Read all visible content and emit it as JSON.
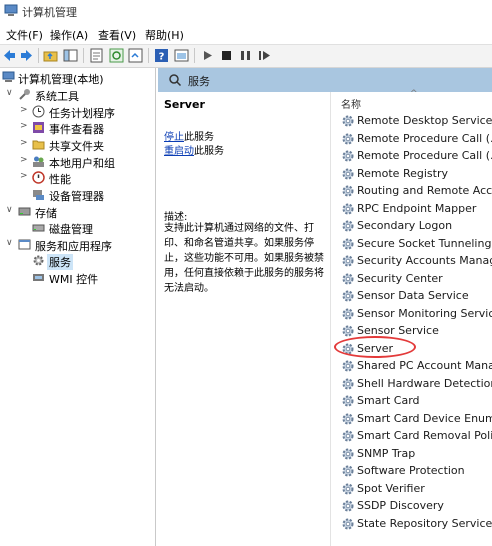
{
  "window": {
    "title": "计算机管理"
  },
  "menu": [
    "文件(F)",
    "操作(A)",
    "查看(V)",
    "帮助(H)"
  ],
  "toolbar_icons": [
    "back-icon",
    "forward-icon",
    "up-folder-icon",
    "show-tree-icon",
    "properties-icon",
    "refresh-icon",
    "export-icon",
    "help-icon",
    "console-icon",
    "play-icon",
    "stop-icon",
    "pause-icon",
    "restart-icon"
  ],
  "tree": [
    {
      "label": "计算机管理(本地)",
      "icon": "computer-icon",
      "twisty": ""
    },
    {
      "label": "系统工具",
      "icon": "tools-icon",
      "twisty": "∨"
    },
    {
      "label": "任务计划程序",
      "icon": "clock-icon",
      "twisty": ">"
    },
    {
      "label": "事件查看器",
      "icon": "event-viewer-icon",
      "twisty": ">"
    },
    {
      "label": "共享文件夹",
      "icon": "shared-folder-icon",
      "twisty": ">"
    },
    {
      "label": "本地用户和组",
      "icon": "users-icon",
      "twisty": ">"
    },
    {
      "label": "性能",
      "icon": "performance-icon",
      "twisty": ">"
    },
    {
      "label": "设备管理器",
      "icon": "device-manager-icon",
      "twisty": ""
    },
    {
      "label": "存储",
      "icon": "storage-icon",
      "twisty": "∨"
    },
    {
      "label": "磁盘管理",
      "icon": "disk-icon",
      "twisty": ""
    },
    {
      "label": "服务和应用程序",
      "icon": "services-apps-icon",
      "twisty": "∨"
    },
    {
      "label": "服务",
      "icon": "services-icon",
      "twisty": ""
    },
    {
      "label": "WMI 控件",
      "icon": "wmi-icon",
      "twisty": ""
    }
  ],
  "pane": {
    "header": "服务",
    "selected_service": "Server",
    "stop_link": "停止",
    "stop_suffix": "此服务",
    "restart_link": "重启动",
    "restart_suffix": "此服务",
    "desc_label": "描述:",
    "description": "支持此计算机通过网络的文件、打印、和命名管道共享。如果服务停止，这些功能不可用。如果服务被禁用，任何直接依赖于此服务的服务将无法启动。"
  },
  "list": {
    "column": "名称",
    "services": [
      "Remote Desktop Service...",
      "Remote Procedure Call (...",
      "Remote Procedure Call (...",
      "Remote Registry",
      "Routing and Remote Acc...",
      "RPC Endpoint Mapper",
      "Secondary Logon",
      "Secure Socket Tunneling ...",
      "Security Accounts Manag...",
      "Security Center",
      "Sensor Data Service",
      "Sensor Monitoring Service",
      "Sensor Service",
      "Server",
      "Shared PC Account Mana...",
      "Shell Hardware Detection",
      "Smart Card",
      "Smart Card Device Enum...",
      "Smart Card Removal Poli...",
      "SNMP Trap",
      "Software Protection",
      "Spot Verifier",
      "SSDP Discovery",
      "State Repository Service"
    ]
  },
  "colors": {
    "header_bg": "#a9c6e0",
    "link": "#0a3cb4",
    "highlight": "#e33a3a",
    "selected_bg": "#cce4f7"
  }
}
